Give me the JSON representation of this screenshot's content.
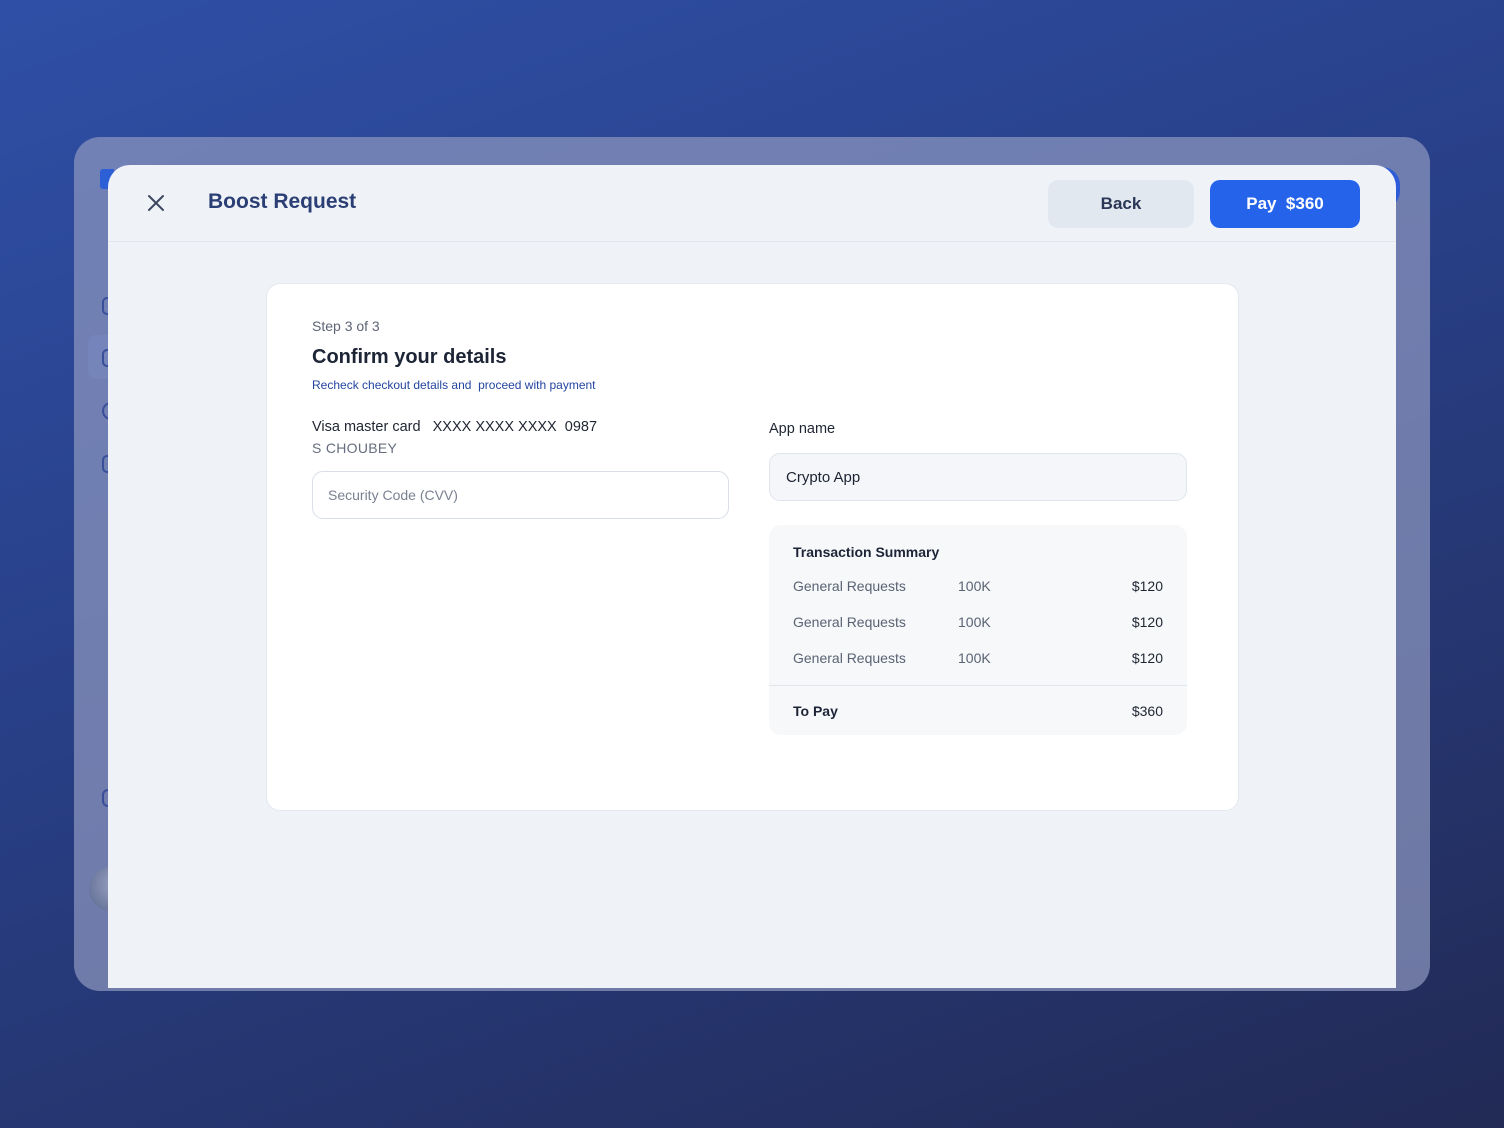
{
  "header": {
    "title": "Boost Request",
    "back_label": "Back",
    "pay_label": "Pay  $360"
  },
  "confirm": {
    "step": "Step 3 of 3",
    "heading": "Confirm your details",
    "subtitle": "Recheck checkout details and  proceed with payment",
    "card_line": "Visa master card   XXXX XXXX XXXX  0987",
    "card_holder": "S CHOUBEY",
    "cvv_placeholder": "Security Code (CVV)",
    "app_name_label": "App name",
    "app_name_value": "Crypto App"
  },
  "summary": {
    "title": "Transaction Summary",
    "rows": [
      {
        "name": "General Requests",
        "qty": "100K",
        "amount": "$120"
      },
      {
        "name": "General Requests",
        "qty": "100K",
        "amount": "$120"
      },
      {
        "name": "General Requests",
        "qty": "100K",
        "amount": "$120"
      }
    ],
    "total_label": "To Pay",
    "total_amount": "$360"
  },
  "colors": {
    "primary": "#2563eb",
    "title_text": "#2b3f75",
    "link_text": "#2445a0"
  },
  "icons": {
    "close": "close-icon"
  }
}
